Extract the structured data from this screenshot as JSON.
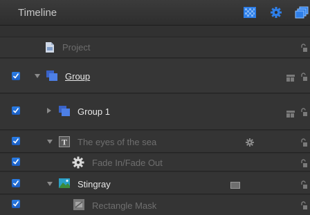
{
  "window": {
    "title": "Timeline"
  },
  "toolbar": {
    "icons": [
      "checkerboard-icon",
      "gear-icon",
      "layers-icon"
    ],
    "accent": "#2f7fe8"
  },
  "rows": [
    {
      "name": "project",
      "label": "Project",
      "checked": false,
      "disclosure": "none",
      "icon": "project-document-icon",
      "dimmed": true
    },
    {
      "name": "group",
      "label": "Group",
      "checked": true,
      "disclosure": "expanded",
      "icon": "group-layers-icon",
      "dimmed": false,
      "underline": true
    },
    {
      "name": "group-1",
      "label": "Group 1",
      "checked": true,
      "disclosure": "collapsed",
      "icon": "group-layers-icon",
      "dimmed": false
    },
    {
      "name": "eyes-of-the-sea",
      "label": "The eyes of the sea",
      "checked": true,
      "disclosure": "expanded",
      "icon": "text-layer-icon",
      "dimmed": true
    },
    {
      "name": "fade-in-fade-out",
      "label": "Fade In/Fade Out",
      "checked": true,
      "disclosure": "none",
      "icon": "behavior-gear-icon",
      "dimmed": true
    },
    {
      "name": "stingray",
      "label": "Stingray",
      "checked": true,
      "disclosure": "expanded",
      "icon": "image-layer-icon",
      "dimmed": false
    },
    {
      "name": "rectangle-mask",
      "label": "Rectangle Mask",
      "checked": true,
      "disclosure": "none",
      "icon": "mask-icon",
      "dimmed": true
    }
  ]
}
